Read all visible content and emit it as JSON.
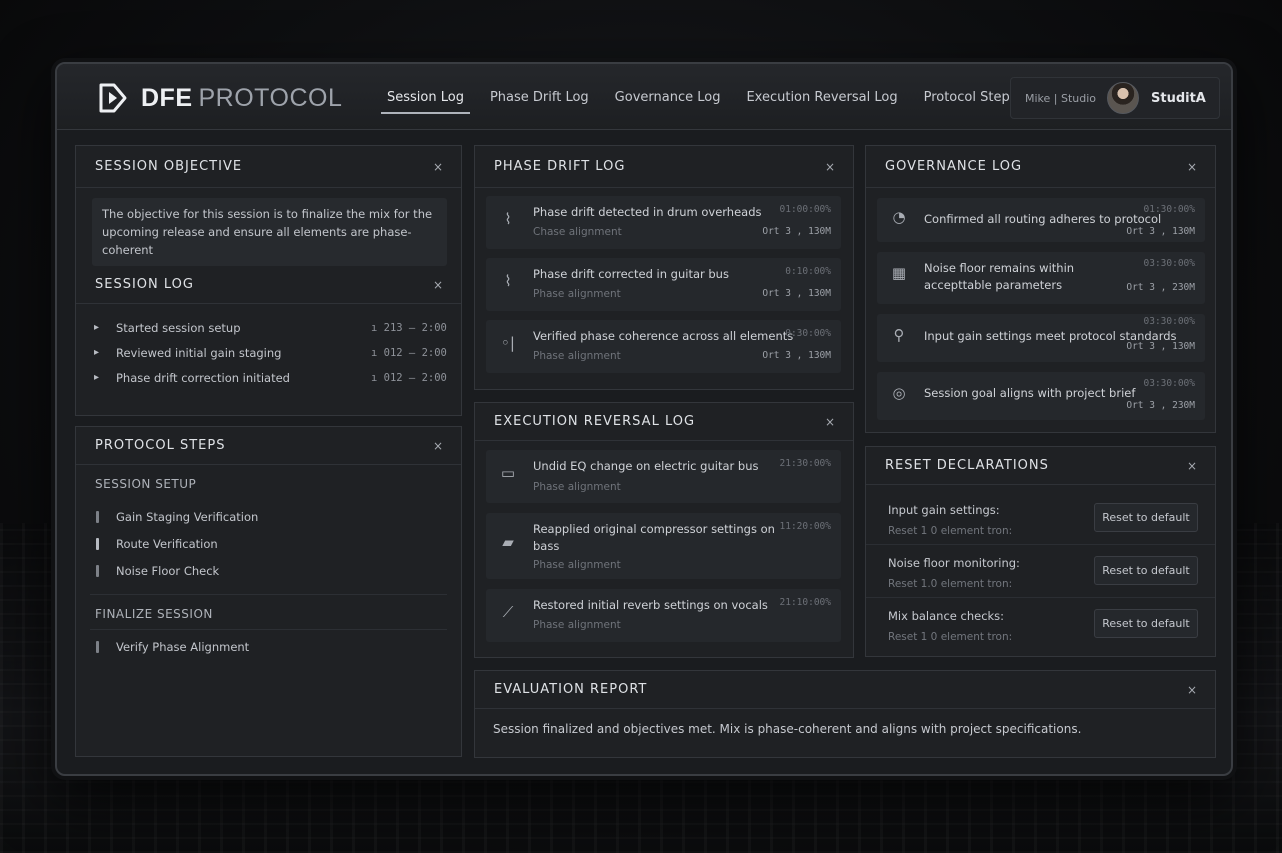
{
  "brand": {
    "strong": "DFE",
    "light": "PROTOCOL"
  },
  "nav": {
    "tabs": [
      {
        "label": "Session Log"
      },
      {
        "label": "Phase Drift Log"
      },
      {
        "label": "Governance Log"
      },
      {
        "label": "Execution Reversal Log"
      },
      {
        "label": "Protocol Steps"
      }
    ],
    "active": "Session Log"
  },
  "user": {
    "context": "Mike | Studio",
    "name": "StuditA"
  },
  "objective": {
    "title": "SESSION OBJECTIVE",
    "text": "The objective for this session is to finalize the mix for the upcoming release and ensure all elements are phase-coherent"
  },
  "session_log": {
    "title": "SESSION LOG",
    "items": [
      {
        "label": "Started session setup",
        "time": "ı 213 – 2:00"
      },
      {
        "label": "Reviewed initial gain staging",
        "time": "ı 012 – 2:00"
      },
      {
        "label": "Phase drift correction initiated",
        "time": "ı 012 – 2:00"
      }
    ]
  },
  "protocol_steps": {
    "title": "PROTOCOL STEPS",
    "sections": [
      {
        "label": "SESSION SETUP",
        "steps": [
          "Gain Staging Verification",
          "Route Verification",
          "Noise Floor Check"
        ]
      },
      {
        "label": "FINALIZE SESSION",
        "steps": [
          "Verify Phase Alignment"
        ]
      }
    ]
  },
  "phase_drift_log": {
    "title": "PHASE DRIFT LOG",
    "entries": [
      {
        "icon": "waveform-icon",
        "title": "Phase drift detected in drum overheads",
        "sub": "Chase alignment",
        "time1": "01:00:00%",
        "time2": "Ort 3 , 130M"
      },
      {
        "icon": "waveform-icon",
        "title": "Phase drift corrected in guitar bus",
        "sub": "Phase alignment",
        "time1": "0:10:00%",
        "time2": "Ort 3 , 130M"
      },
      {
        "icon": "phase-meter-icon",
        "title": "Verified phase coherence across all elements",
        "sub": "Phase alignment",
        "time1": "0:30:00%",
        "time2": "Ort 3 , 130M"
      }
    ]
  },
  "execution_reversal_log": {
    "title": "EXECUTION REVERSAL LOG",
    "entries": [
      {
        "icon": "eq-icon",
        "title": "Undid EQ change on electric guitar bus",
        "sub": "Phase alignment",
        "time1": "21:30:00%"
      },
      {
        "icon": "compressor-icon",
        "title": "Reapplied original compressor settings on bass",
        "sub": "Phase alignment",
        "time1": "11:20:00%"
      },
      {
        "icon": "reverb-icon",
        "title": "Restored initial reverb settings on vocals",
        "sub": "Phase alignment",
        "time1": "21:10:00%"
      }
    ]
  },
  "governance_log": {
    "title": "GOVERNANCE LOG",
    "entries": [
      {
        "icon": "routing-icon",
        "title": "Confirmed all routing adheres to protocol",
        "time1": "01:30:00%",
        "time2": "Ort 3 , 130M"
      },
      {
        "icon": "meter-icon",
        "title": "Noise floor remains within accepttable parameters",
        "time1": "03:30:00%",
        "time2": "Ort 3 , 230M"
      },
      {
        "icon": "pin-icon",
        "title": "Input gain settings meet protocol standards",
        "time1": "03:30:00%",
        "time2": "Ort 3 , 130M"
      },
      {
        "icon": "target-icon",
        "title": "Session goal aligns with project brief",
        "time1": "03:30:00%",
        "time2": "Ort 3 , 230M"
      }
    ]
  },
  "reset_declarations": {
    "title": "RESET DECLARATIONS",
    "items": [
      {
        "label": "Input gain settings:",
        "sub": "Reset 1 0 element tron:",
        "button": "Reset to default"
      },
      {
        "label": "Noise floor monitoring:",
        "sub": "Reset 1.0 element tron:",
        "button": "Reset to default"
      },
      {
        "label": "Mix balance checks:",
        "sub": "Reset 1 0 element tron:",
        "button": "Reset to default"
      }
    ]
  },
  "evaluation": {
    "title": "EVALUATION REPORT",
    "text": "Session finalized and objectives met. Mix is phase-coherent and aligns with project specifications."
  },
  "close_glyph": "×"
}
